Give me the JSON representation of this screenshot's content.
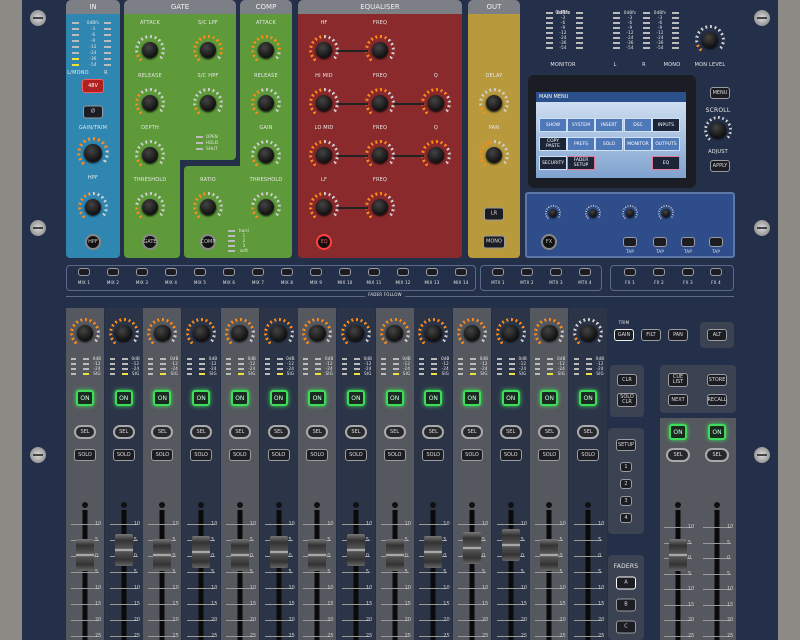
{
  "in": {
    "title": "IN",
    "meter_scale": [
      "0dBfs",
      "-3",
      "-6",
      "-9",
      "-12",
      "-24",
      "-36",
      "-54"
    ],
    "left": "L/MONO",
    "right": "R",
    "phantom": "48V",
    "phase": "Ø",
    "gain": "GAIN/TRIM",
    "hpf_knob": "HPF",
    "hpf_button": "HPF"
  },
  "gate": {
    "title": "GATE",
    "attack": "ATTACK",
    "sc_lpf": "S/C LPF",
    "release": "RELEASE",
    "sc_hpf": "S/C HPF",
    "depth": "DEPTH",
    "threshold": "THRESHOLD",
    "modes": [
      "OPEN",
      "HOLD",
      "SHUT"
    ],
    "button": "GATE"
  },
  "comp": {
    "title": "COMP",
    "attack": "ATTACK",
    "release": "RELEASE",
    "gain": "GAIN",
    "ratio": "RATIO",
    "threshold": "THRESHOLD",
    "knee": [
      "hard",
      "1",
      "2",
      "3",
      "soft"
    ],
    "button": "COMP"
  },
  "eq": {
    "title": "EQUALISER",
    "hf": "HF",
    "hi_mid": "HI MID",
    "lo_mid": "LO MID",
    "lf": "LF",
    "freq": "FREQ",
    "q": "Q",
    "button": "EQ"
  },
  "out": {
    "title": "OUT",
    "delay": "DELAY",
    "pan": "PAN",
    "lr": "LR",
    "mono": "MONO"
  },
  "meters": {
    "scale": [
      "0dBfs",
      "-3",
      "-6",
      "-9",
      "-12",
      "-24",
      "-36",
      "-54"
    ],
    "monitor": "MONITOR",
    "l": "L",
    "r": "R",
    "mono": "MONO",
    "mon_level": "MON LEVEL"
  },
  "screen": {
    "title": "MAIN MENU",
    "buttons": [
      "SHOW",
      "SYSTEM",
      "INSERT",
      "DSC",
      "INPUTS",
      "COPY PASTE",
      "PREFS",
      "SOLO",
      "MONITOR",
      "OUTPUTS",
      "SECURITY",
      "FADER SETUP",
      "EQ"
    ]
  },
  "nav": {
    "menu": "MENU",
    "scroll": "SCROLL",
    "adjust": "ADJUST",
    "apply": "APPLY"
  },
  "fx": {
    "button": "FX",
    "tap": "TAP"
  },
  "mix": {
    "mix": [
      "MIX 1",
      "MIX 2",
      "MIX 3",
      "MIX 4",
      "MIX 5",
      "MIX 6",
      "MIX 7",
      "MIX 8",
      "MIX 9",
      "MIX 10",
      "MIX 11",
      "MIX 12",
      "MIX 13",
      "MIX 14"
    ],
    "mtx": [
      "MTX 1",
      "MTX 2",
      "MTX 3",
      "MTX 4"
    ],
    "fxs": [
      "FX 1",
      "FX 2",
      "FX 3",
      "FX 4"
    ],
    "fader_follow": "FADER FOLLOW"
  },
  "strip": {
    "on": "ON",
    "sel": "SEL",
    "solo": "SOLO",
    "meter": [
      "0dB",
      "-12",
      "-24",
      "SIG"
    ],
    "scale": [
      "10",
      "5",
      "0",
      "5",
      "10",
      "15",
      "20",
      "25"
    ]
  },
  "trim": {
    "label": "TRIM",
    "gain": "GAIN",
    "filt": "FILT",
    "pan": "PAN",
    "alt": "ALT"
  },
  "solo_clear": {
    "clr": "CLR",
    "solo_clr": "SOLO CLR"
  },
  "scenes": {
    "cue_list": "CUE LIST",
    "store": "STORE",
    "next": "NEXT",
    "recall": "RECALL"
  },
  "layers": {
    "setup": "SETUP",
    "items": [
      "1",
      "2",
      "3",
      "4"
    ],
    "faders": "FADERS",
    "banks": [
      "A",
      "B",
      "C"
    ]
  },
  "colors": {
    "in": "#2f86b0",
    "gate": "#5e9a3a",
    "eq": "#8a2a2c",
    "out": "#b89a3c",
    "led": "#ff8c1a",
    "on": "#3ddc5a"
  }
}
